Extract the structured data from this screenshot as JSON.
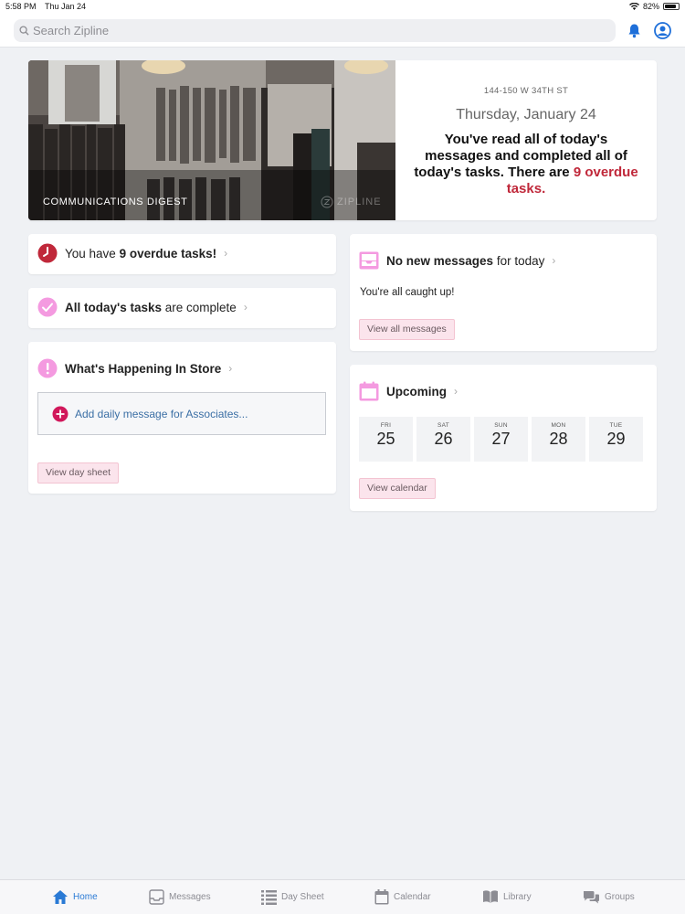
{
  "status_bar": {
    "time": "5:58 PM",
    "date": "Thu Jan 24",
    "battery": "82%"
  },
  "search": {
    "placeholder": "Search Zipline"
  },
  "hero": {
    "caption": "COMMUNICATIONS DIGEST",
    "logo": "ZIPLINE",
    "address": "144-150 W 34TH ST",
    "date": "Thursday, January 24",
    "message_start": "You've read all of today's messages and completed all of today's tasks. There are ",
    "message_highlight": "9 overdue tasks",
    "message_end": "."
  },
  "overdue": {
    "prefix": "You have ",
    "count": "9",
    "suffix": " overdue tasks!"
  },
  "complete": {
    "bold": "All today's tasks",
    "rest": " are complete"
  },
  "happening": {
    "title": "What's Happening In Store",
    "add_label": "Add daily message for Associates...",
    "button": "View day sheet"
  },
  "messages": {
    "title_bold": "No new messages",
    "title_rest": " for today",
    "body": "You're all caught up!",
    "button": "View all messages"
  },
  "upcoming": {
    "title": "Upcoming",
    "days": [
      {
        "dow": "FRI",
        "num": "25"
      },
      {
        "dow": "SAT",
        "num": "26"
      },
      {
        "dow": "SUN",
        "num": "27"
      },
      {
        "dow": "MON",
        "num": "28"
      },
      {
        "dow": "TUE",
        "num": "29"
      }
    ],
    "button": "View calendar"
  },
  "tabs": {
    "home": "Home",
    "messages": "Messages",
    "daysheet": "Day Sheet",
    "calendar": "Calendar",
    "library": "Library",
    "groups": "Groups"
  },
  "colors": {
    "accent_blue": "#2a7ad5",
    "alert_red": "#c0283a",
    "pink_icon": "#f49ae0"
  }
}
